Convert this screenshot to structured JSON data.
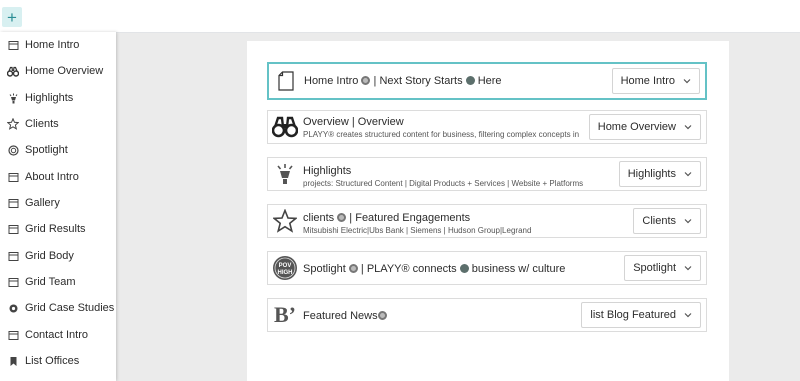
{
  "toolbar": {
    "add_label": "+"
  },
  "sidebar": {
    "items": [
      {
        "label": "Home Intro",
        "icon": "block-icon"
      },
      {
        "label": "Home Overview",
        "icon": "binoculars-icon"
      },
      {
        "label": "Highlights",
        "icon": "lamp-icon"
      },
      {
        "label": "Clients",
        "icon": "star-icon"
      },
      {
        "label": "Spotlight",
        "icon": "spotlight-icon"
      },
      {
        "label": "About Intro",
        "icon": "block-icon"
      },
      {
        "label": "Gallery",
        "icon": "block-icon"
      },
      {
        "label": "Grid Results",
        "icon": "block-icon"
      },
      {
        "label": "Grid Body",
        "icon": "block-icon"
      },
      {
        "label": "Grid Team",
        "icon": "block-icon"
      },
      {
        "label": "Grid Case Studies",
        "icon": "gear-icon"
      },
      {
        "label": "Contact Intro",
        "icon": "block-icon"
      },
      {
        "label": "List Offices",
        "icon": "bookmark-icon"
      }
    ]
  },
  "blocks": [
    {
      "icon": "document-icon",
      "title_pre": "Home Intro ",
      "title_mid": " | Next Story Starts ",
      "title_post": " Here",
      "select": "Home Intro"
    },
    {
      "icon": "binoculars-icon",
      "title": "Overview  | Overview",
      "subtitle": "PLAYY® creates structured content for business, filtering complex concepts in",
      "select": "Home Overview"
    },
    {
      "icon": "lamp-icon",
      "title": "Highlights",
      "subtitle": "projects: Structured Content | Digital Products + Services | Website + Platforms",
      "select": "Highlights"
    },
    {
      "icon": "star-icon",
      "title_pre": "clients  ",
      "title_post": " | Featured Engagements",
      "subtitle": "Mitsubishi Electric|Ubs Bank | Siemens | Hudson Group|Legrand",
      "select": "Clients"
    },
    {
      "icon": "spotlight-icon",
      "icon_text": "POV",
      "icon_text2": "HIGH",
      "title_pre": "Spotlight ",
      "title_mid": " | PLAYY® connects ",
      "title_post": " business w/  culture",
      "select": "Spotlight"
    },
    {
      "icon": "blog-icon",
      "icon_text": "B’",
      "title_pre": "Featured News",
      "select": "list Blog Featured"
    }
  ]
}
